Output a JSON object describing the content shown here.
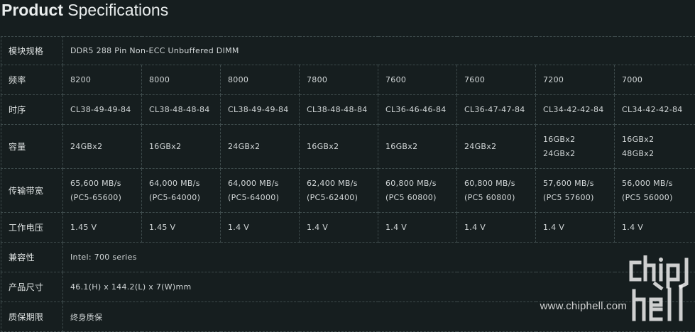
{
  "header": {
    "title_bold": "Product",
    "title_rest": "Specifications"
  },
  "rows": [
    {
      "label": "模块规格",
      "span": true,
      "value": "DDR5 288 Pin Non-ECC Unbuffered DIMM"
    },
    {
      "label": "频率",
      "cells": [
        [
          "8200"
        ],
        [
          "8000"
        ],
        [
          "8000"
        ],
        [
          "7800"
        ],
        [
          "7600"
        ],
        [
          "7600"
        ],
        [
          "7200"
        ],
        [
          "7000"
        ]
      ]
    },
    {
      "label": "时序",
      "cells": [
        [
          "CL38-49-49-84"
        ],
        [
          "CL38-48-48-84"
        ],
        [
          "CL38-49-49-84"
        ],
        [
          "CL38-48-48-84"
        ],
        [
          "CL36-46-46-84"
        ],
        [
          "CL36-47-47-84"
        ],
        [
          "CL34-42-42-84"
        ],
        [
          "CL34-42-42-84"
        ]
      ]
    },
    {
      "label": "容量",
      "cells": [
        [
          "24GBx2"
        ],
        [
          "16GBx2"
        ],
        [
          "24GBx2"
        ],
        [
          "16GBx2"
        ],
        [
          "16GBx2"
        ],
        [
          "24GBx2"
        ],
        [
          "16GBx2",
          "24GBx2"
        ],
        [
          "16GBx2",
          "48GBx2"
        ]
      ]
    },
    {
      "label": "传输带宽",
      "cells": [
        [
          "65,600 MB/s",
          "(PC5-65600)"
        ],
        [
          "64,000 MB/s",
          "(PC5-64000)"
        ],
        [
          "64,000 MB/s",
          "(PC5-64000)"
        ],
        [
          "62,400 MB/s",
          "(PC5-62400)"
        ],
        [
          "60,800 MB/s",
          "(PC5 60800)"
        ],
        [
          "60,800 MB/s",
          "(PC5 60800)"
        ],
        [
          "57,600 MB/s",
          "(PC5 57600)"
        ],
        [
          "56,000 MB/s",
          "(PC5 56000)"
        ]
      ]
    },
    {
      "label": "工作电压",
      "cells": [
        [
          "1.45 V"
        ],
        [
          "1.45 V"
        ],
        [
          "1.4 V"
        ],
        [
          "1.4 V"
        ],
        [
          "1.4 V"
        ],
        [
          "1.4 V"
        ],
        [
          "1.4 V"
        ],
        [
          "1.4 V"
        ]
      ]
    },
    {
      "label": "兼容性",
      "span": true,
      "value": "Intel: 700 series"
    },
    {
      "label": "产品尺寸",
      "span": true,
      "value": "46.1(H) x 144.2(L) x 7(W)mm"
    },
    {
      "label": "质保期限",
      "span": true,
      "value": "终身质保"
    }
  ],
  "watermark": {
    "url": "www.chiphell.com",
    "logo": "chip hell"
  }
}
